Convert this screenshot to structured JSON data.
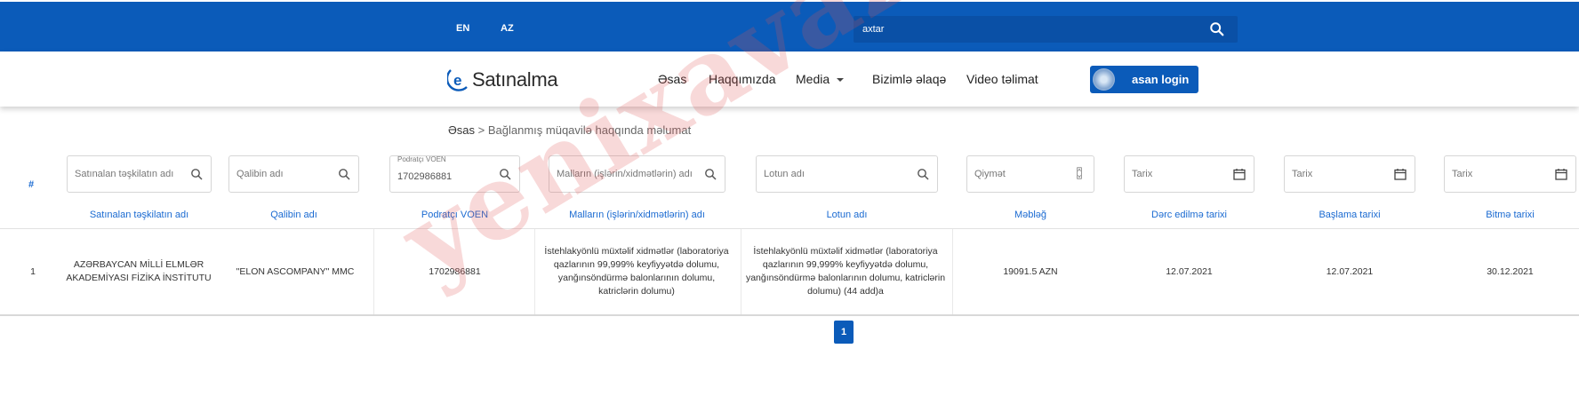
{
  "header": {
    "languages": [
      "EN",
      "AZ"
    ],
    "search_placeholder": "axtar"
  },
  "nav": {
    "logo_text": "Satınalma",
    "menu": [
      "Əsas",
      "Haqqımızda",
      "Media",
      "Bizimlə əlaqə",
      "Video təlimat"
    ],
    "login_label": "asan login"
  },
  "breadcrumb": {
    "home": "Əsas",
    "separator": ">",
    "current": "Bağlanmış müqavilə haqqında məlumat"
  },
  "filters": {
    "org_placeholder": "Satınalan təşkilatın adı",
    "template_placeholder": "Qalibin adı",
    "voen_label": "Podratçı VOEN",
    "voen_value": "1702986881",
    "goods_placeholder": "Malların (işlərin/xidmətlərin) adı",
    "lot_placeholder": "Lotun adı",
    "price_placeholder": "Qiymət",
    "date_placeholder": "Tarix"
  },
  "table": {
    "index_header": "#",
    "headers": [
      "Satınalan təşkilatın adı",
      "Qalibin adı",
      "Podratçı VOEN",
      "Malların (işlərin/xidmətlərin) adı",
      "Lotun adı",
      "Məbləğ",
      "Dərc edilmə tarixi",
      "Başlama tarixi",
      "Bitmə tarixi"
    ],
    "rows": [
      {
        "index": "1",
        "org": "AZƏRBAYCAN MİLLİ ELMLƏR AKADEMİYASI FİZİKA İNSTİTUTU",
        "winner": "\"ELON ASCOMPANY\" MMC",
        "voen": "1702986881",
        "goods": "İstehlakyönlü müxtəlif xidmətlər (laboratoriya qazlarının 99,999% keyfiyyətdə dolumu, yanğınsöndürmə balonlarının dolumu, katriclərin dolumu)",
        "lot": "İstehlakyönlü müxtəlif xidmətlər (laboratoriya qazlarının 99,999% keyfiyyətdə dolumu, yanğınsöndürmə balonlarının dolumu, katriclərin dolumu) (44 add)a",
        "amount": "19091.5 AZN",
        "published": "12.07.2021",
        "start": "12.07.2021",
        "end": "30.12.2021"
      }
    ]
  },
  "pagination": {
    "current": "1"
  },
  "watermark": "yenixavaz.com",
  "colors": {
    "brand_blue": "#0b5bb9",
    "link_blue": "#1a6ad1"
  }
}
